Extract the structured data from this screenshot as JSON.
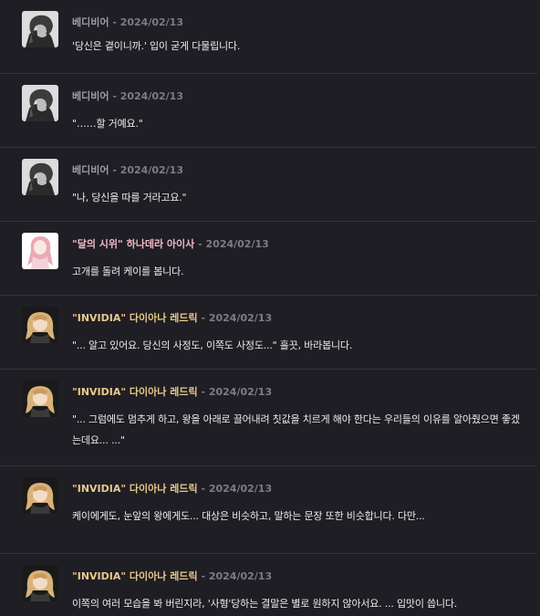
{
  "colors": {
    "background": "#1f1e24",
    "divider": "#34333b",
    "name_gray": "#9d9ca6",
    "name_pink": "#f3b8c8",
    "name_gold": "#e8c98c",
    "date": "#7d7c86",
    "text": "#ececec"
  },
  "messages": [
    {
      "author": "베디비어",
      "sep": " - ",
      "date": "2024/02/13",
      "text": "'당신은 곁이니까.' 입이 굳게 다물립니다.",
      "avatar": "dark-haired-man-avatar-icon"
    },
    {
      "author": "베디비어",
      "sep": " - ",
      "date": "2024/02/13",
      "text": "\"……할 거예요.\"",
      "avatar": "dark-haired-man-avatar-icon"
    },
    {
      "author": "베디비어",
      "sep": " - ",
      "date": "2024/02/13",
      "text": "\"나, 당신을 따를 거라고요.\"",
      "avatar": "dark-haired-man-avatar-icon"
    },
    {
      "author": "\"달의 시위\" 하나데라 아이사",
      "sep": " - ",
      "date": "2024/02/13",
      "text": "고개를 돌려 케이를 봅니다.",
      "avatar": "pink-haired-girl-avatar-icon"
    },
    {
      "author": "\"INVIDIA\" 다이아나 레드릭",
      "sep": " - ",
      "date": "2024/02/13",
      "text": "\"... 알고 있어요. 당신의 사정도, 이쪽도 사정도...\" 흘끗, 바라봅니다.",
      "avatar": "blonde-girl-avatar-icon"
    },
    {
      "author": "\"INVIDIA\" 다이아나 레드릭",
      "sep": " - ",
      "date": "2024/02/13",
      "text": "\"... 그럼에도 멈추게 하고, 왕을 아래로 끌어내려 칫값을 치르게 해야 한다는 우리들의 이유를 알아줬으면 좋겠는데요... ...\"",
      "avatar": "blonde-girl-avatar-icon"
    },
    {
      "author": "\"INVIDIA\" 다이아나 레드릭",
      "sep": " - ",
      "date": "2024/02/13",
      "text": "케이에게도, 눈앞의 왕에게도... 대상은 비슷하고, 말하는 문장 또한 비슷합니다. 다만...",
      "avatar": "blonde-girl-avatar-icon"
    },
    {
      "author": "\"INVIDIA\" 다이아나 레드릭",
      "sep": " - ",
      "date": "2024/02/13",
      "text": "이쪽의 여러 모습을 봐 버린지라, '사형'당하는 결말은 별로 원하지 않아서요. ... 입맛이 씁니다.",
      "avatar": "blonde-girl-avatar-icon"
    }
  ]
}
